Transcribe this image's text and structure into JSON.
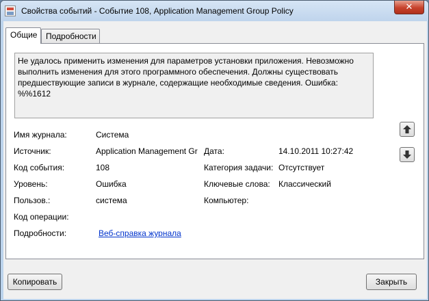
{
  "window": {
    "title": "Свойства событий - Событие 108, Application Management Group Policy",
    "close_glyph": "✕"
  },
  "tabs": [
    {
      "label": "Общие",
      "active": true
    },
    {
      "label": "Подробности",
      "active": false
    }
  ],
  "general": {
    "message": "Не удалось применить изменения для параметров установки приложения. Невозможно выполнить изменения для этого программного обеспечения. Должны существовать предшествующие записи в журнале, содержащие необходимые сведения.  Ошибка: %%1612",
    "fields": {
      "log_name": {
        "label": "Имя журнала:",
        "value": "Система"
      },
      "source": {
        "label": "Источник:",
        "value": "Application Management Gr"
      },
      "date": {
        "label": "Дата:",
        "value": "14.10.2011 10:27:42"
      },
      "event_id": {
        "label": "Код события:",
        "value": "108"
      },
      "task_category": {
        "label": "Категория задачи:",
        "value": "Отсутствует"
      },
      "level": {
        "label": "Уровень:",
        "value": "Ошибка"
      },
      "keywords": {
        "label": "Ключевые слова:",
        "value": "Классический"
      },
      "user": {
        "label": "Пользов.:",
        "value": "система"
      },
      "computer": {
        "label": "Компьютер:",
        "value": ""
      },
      "opcode": {
        "label": "Код операции:",
        "value": ""
      },
      "more_info": {
        "label": "Подробности:",
        "link": "Веб-справка журнала "
      }
    }
  },
  "buttons": {
    "copy": "Копировать",
    "close": "Закрыть"
  },
  "icons": {
    "prev_event": "arrow-up-icon",
    "next_event": "arrow-down-icon",
    "title": "event-viewer-icon"
  }
}
